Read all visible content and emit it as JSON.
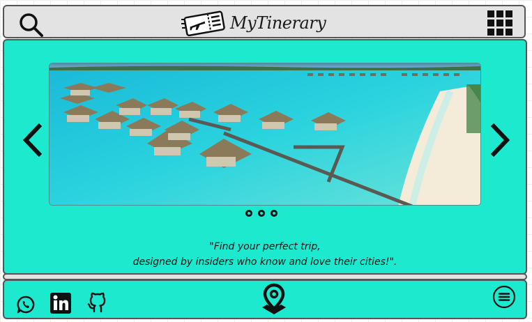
{
  "header": {
    "logo_text": "MyTinerary",
    "icons": {
      "search": "search-icon",
      "logo": "ticket-plane-icon",
      "menu": "grid-menu-icon"
    }
  },
  "carousel": {
    "image_description_icon": "overwater-bungalows-photo",
    "prev_icon": "chevron-left-icon",
    "next_icon": "chevron-right-icon",
    "dot_count": 3
  },
  "tagline": {
    "line1": "\"Find your perfect trip,",
    "line2": "designed by insiders who know and love their cities!\"."
  },
  "footer": {
    "icons": [
      "whatsapp-icon",
      "linkedin-icon",
      "github-icon",
      "location-pin-icon",
      "hamburger-menu-icon"
    ]
  },
  "colors": {
    "accent": "#1de9cf",
    "bar": "#e3e3e3",
    "outline": "#555555",
    "ink": "#111111"
  }
}
